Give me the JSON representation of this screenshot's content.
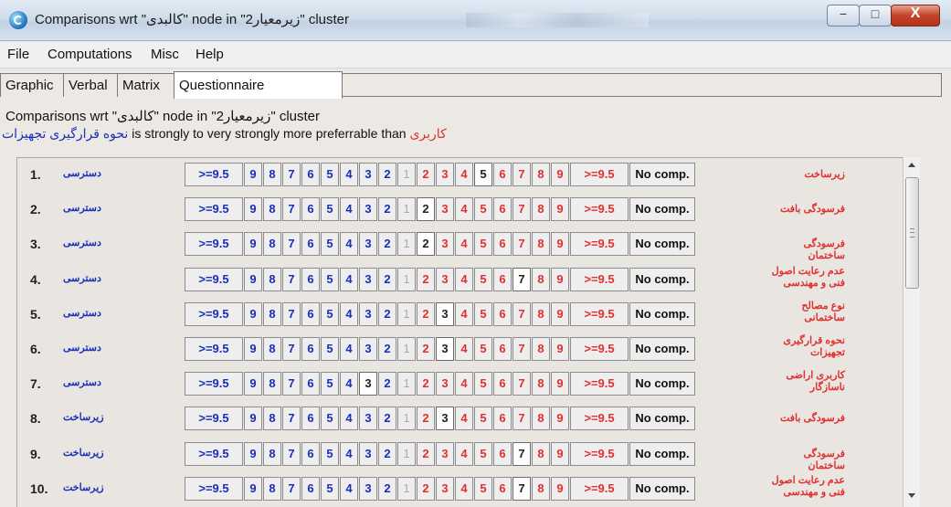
{
  "window": {
    "title": "Comparisons wrt \"کالبدی\" node in \"زیرمعیار2\" cluster",
    "controls": {
      "minimize": "−",
      "maximize": "□",
      "close": "X"
    }
  },
  "menu": [
    "File",
    "Computations",
    "Misc",
    "Help"
  ],
  "tabs": [
    {
      "label": "Graphic",
      "active": false
    },
    {
      "label": "Verbal",
      "active": false
    },
    {
      "label": "Matrix",
      "active": false
    },
    {
      "label": "Questionnaire",
      "active": true
    }
  ],
  "header": {
    "line1": "Comparisons wrt \"کالبدی\" node in \"زیرمعیار2\" cluster",
    "line2_left": "نحوه قرارگیری تجهیزات",
    "line2_middle": " is strongly to very strongly more preferrable than ",
    "line2_right": "کاربری"
  },
  "scale": {
    "left": [
      ">=9.5",
      "9",
      "8",
      "7",
      "6",
      "5",
      "4",
      "3",
      "2"
    ],
    "center": "1",
    "right": [
      "2",
      "3",
      "4",
      "5",
      "6",
      "7",
      "8",
      "9",
      ">=9.5"
    ],
    "no_comp": "No comp."
  },
  "rows": [
    {
      "num": "1.",
      "left": "دسترسی",
      "right": "زیرساخت",
      "selected": "R5"
    },
    {
      "num": "2.",
      "left": "دسترسی",
      "right": "فرسودگی بافت",
      "selected": "R2"
    },
    {
      "num": "3.",
      "left": "دسترسی",
      "right": "فرسودگی ساختمان",
      "selected": "R2"
    },
    {
      "num": "4.",
      "left": "دسترسی",
      "right": "عدم رعایت اصول فنی و مهندسی",
      "selected": "R7"
    },
    {
      "num": "5.",
      "left": "دسترسی",
      "right": "نوع مصالح ساختمانی",
      "selected": "R3"
    },
    {
      "num": "6.",
      "left": "دسترسی",
      "right": "نحوه قرارگیری تجهیزات",
      "selected": "R3"
    },
    {
      "num": "7.",
      "left": "دسترسی",
      "right": "کاربری اراضی ناسازگار",
      "selected": "L3"
    },
    {
      "num": "8.",
      "left": "زیرساخت",
      "right": "فرسودگی بافت",
      "selected": "R3"
    },
    {
      "num": "9.",
      "left": "زیرساخت",
      "right": "فرسودگی ساختمان",
      "selected": "R7"
    },
    {
      "num": "10.",
      "left": "زیرساخت",
      "right": "عدم رعایت اصول فنی و مهندسی",
      "selected": "R7"
    }
  ],
  "colors": {
    "left_text": "#1a2fb8",
    "right_text": "#e03030",
    "panel_bg": "#e9e6e1"
  }
}
